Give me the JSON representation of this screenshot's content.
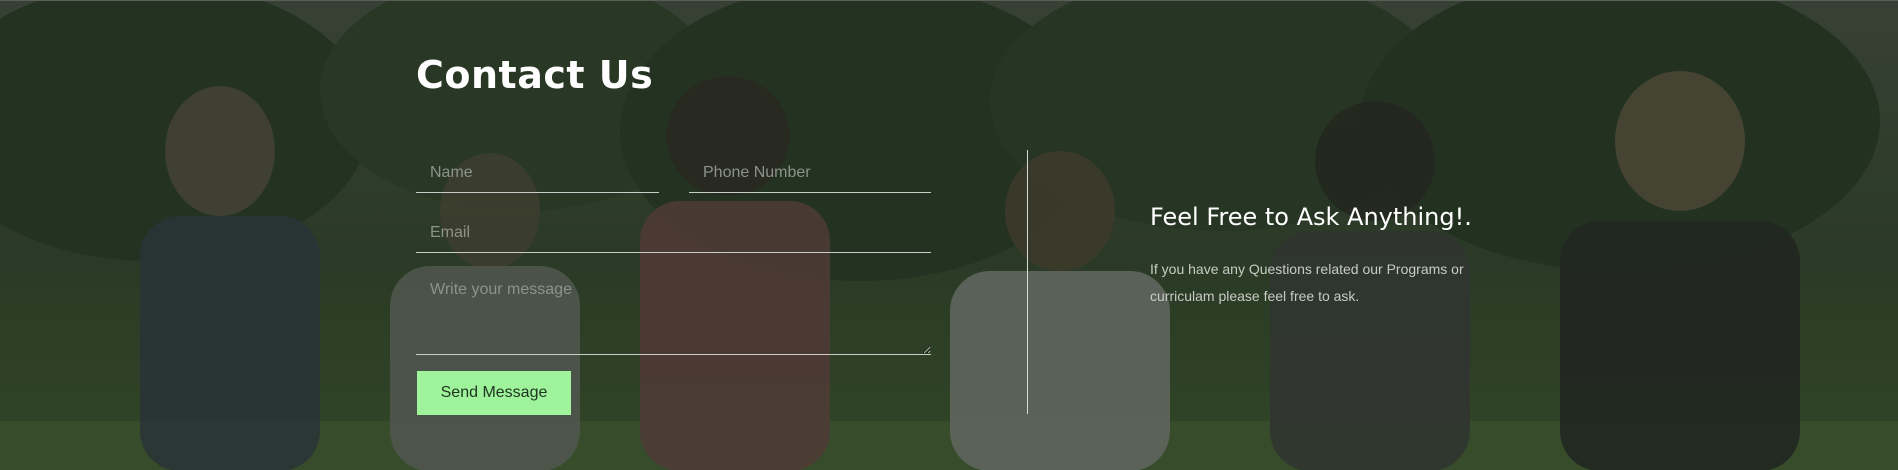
{
  "contact": {
    "title": "Contact Us",
    "form": {
      "name_placeholder": "Name",
      "phone_placeholder": "Phone Number",
      "email_placeholder": "Email",
      "message_placeholder": "Write your message",
      "send_label": "Send Message"
    },
    "info": {
      "heading": "Feel Free to Ask Anything!.",
      "text": "If you have any Questions related our Programs or curriculam please feel free to ask."
    }
  },
  "colors": {
    "accent": "#9ef39b",
    "overlay": "#1e261e",
    "text": "#ffffff"
  }
}
